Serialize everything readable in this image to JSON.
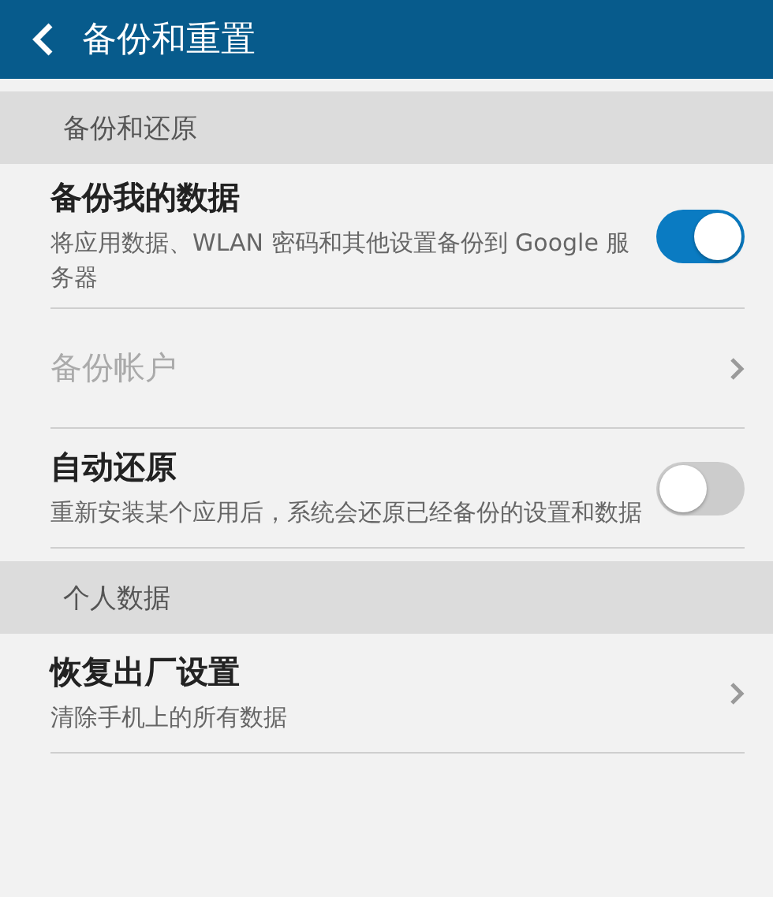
{
  "header": {
    "title": "备份和重置"
  },
  "sections": [
    {
      "title": "备份和还原",
      "items": [
        {
          "kind": "toggle",
          "title": "备份我的数据",
          "subtitle": "将应用数据、WLAN 密码和其他设置备份到 Google 服务器",
          "on": true,
          "disabled": false
        },
        {
          "kind": "link",
          "title": "备份帐户",
          "disabled": true
        },
        {
          "kind": "toggle",
          "title": "自动还原",
          "subtitle": "重新安装某个应用后，系统会还原已经备份的设置和数据",
          "on": false,
          "disabled": false
        }
      ]
    },
    {
      "title": "个人数据",
      "items": [
        {
          "kind": "link",
          "title": "恢复出厂设置",
          "subtitle": "清除手机上的所有数据",
          "disabled": false
        }
      ]
    }
  ]
}
